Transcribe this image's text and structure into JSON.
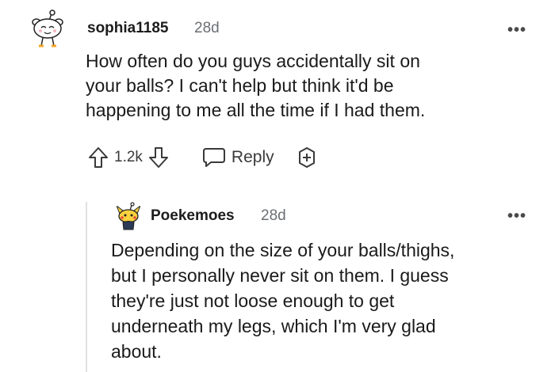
{
  "comment": {
    "username": "sophia1185",
    "age": "28d",
    "more_label": "•••",
    "body": "How often do you guys accidentally sit on\nyour balls? I can't help but think it'd be\nhappening to me all the time if I had them.",
    "votes": "1.2k",
    "reply_label": "Reply",
    "icons": {
      "avatar": "snoo-avatar-icon",
      "upvote": "arrow-up-icon",
      "downvote": "arrow-down-icon",
      "reply": "speech-bubble-icon",
      "award": "award-plus-icon"
    }
  },
  "reply": {
    "username": "Poekemoes",
    "age": "28d",
    "more_label": "•••",
    "body": "Depending on the size of your balls/thighs,\nbut I personally never sit on them. I guess\nthey're just not loose enough to get\nunderneath my legs, which I'm very glad\nabout.",
    "icons": {
      "avatar": "snoo-avatar-icon"
    }
  },
  "colors": {
    "text": "#1c1c1c",
    "muted": "#6b6f73",
    "thread_line": "#e0e0e0"
  }
}
